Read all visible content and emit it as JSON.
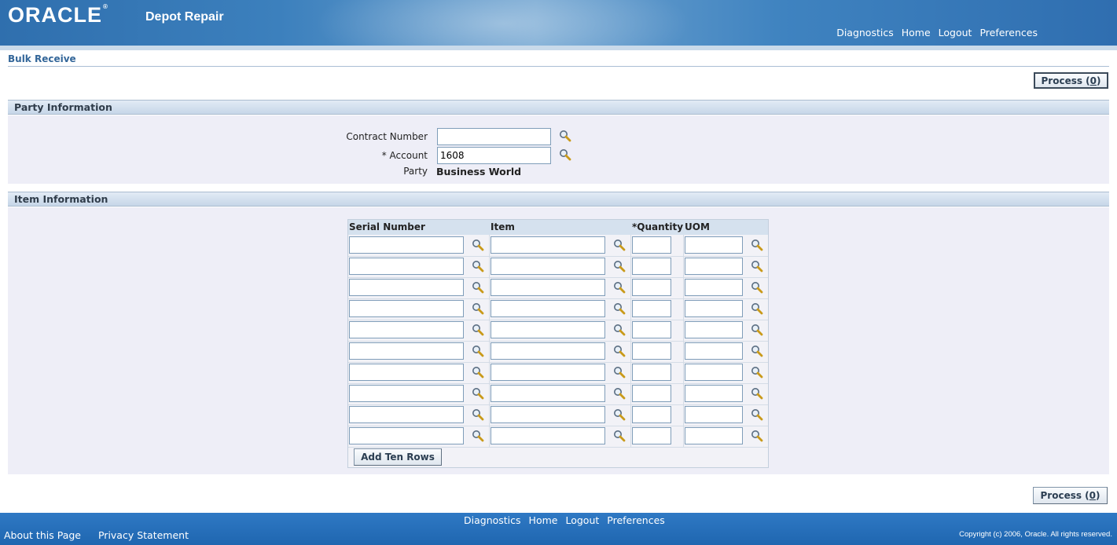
{
  "header": {
    "logo_text": "ORACLE",
    "app_name": "Depot Repair",
    "global_links": [
      "Diagnostics",
      "Home",
      "Logout",
      "Preferences"
    ]
  },
  "page": {
    "title": "Bulk Receive",
    "process_button_label": "Process (0)",
    "process_button_text": "Process (",
    "process_button_accel": "0",
    "process_button_close": ")"
  },
  "party_section": {
    "title": "Party Information",
    "contract_number_label": "Contract Number",
    "contract_number_value": "",
    "account_required_marker": "*",
    "account_label": "Account",
    "account_value": "1608",
    "party_label": "Party",
    "party_value": "Business World"
  },
  "item_section": {
    "title": "Item Information",
    "columns": {
      "serial_number": "Serial Number",
      "item": "Item",
      "quantity_required_marker": "*",
      "quantity": "Quantity",
      "uom": "UOM"
    },
    "row_count": 10,
    "rows": [
      {
        "serial_number": "",
        "item": "",
        "quantity": "",
        "uom": ""
      },
      {
        "serial_number": "",
        "item": "",
        "quantity": "",
        "uom": ""
      },
      {
        "serial_number": "",
        "item": "",
        "quantity": "",
        "uom": ""
      },
      {
        "serial_number": "",
        "item": "",
        "quantity": "",
        "uom": ""
      },
      {
        "serial_number": "",
        "item": "",
        "quantity": "",
        "uom": ""
      },
      {
        "serial_number": "",
        "item": "",
        "quantity": "",
        "uom": ""
      },
      {
        "serial_number": "",
        "item": "",
        "quantity": "",
        "uom": ""
      },
      {
        "serial_number": "",
        "item": "",
        "quantity": "",
        "uom": ""
      },
      {
        "serial_number": "",
        "item": "",
        "quantity": "",
        "uom": ""
      },
      {
        "serial_number": "",
        "item": "",
        "quantity": "",
        "uom": ""
      }
    ],
    "add_rows_button": "Add Ten Rows"
  },
  "footer": {
    "links": [
      "Diagnostics",
      "Home",
      "Logout",
      "Preferences"
    ],
    "about_link": "About this Page",
    "privacy_link": "Privacy Statement",
    "copyright": "Copyright (c) 2006, Oracle. All rights reserved."
  },
  "icons": {
    "lov": "magnifier-search-icon"
  },
  "colors": {
    "header_blue": "#3c80bd",
    "section_header": "#c6d6e8",
    "section_body": "#eeeef7",
    "title_text": "#336699"
  }
}
